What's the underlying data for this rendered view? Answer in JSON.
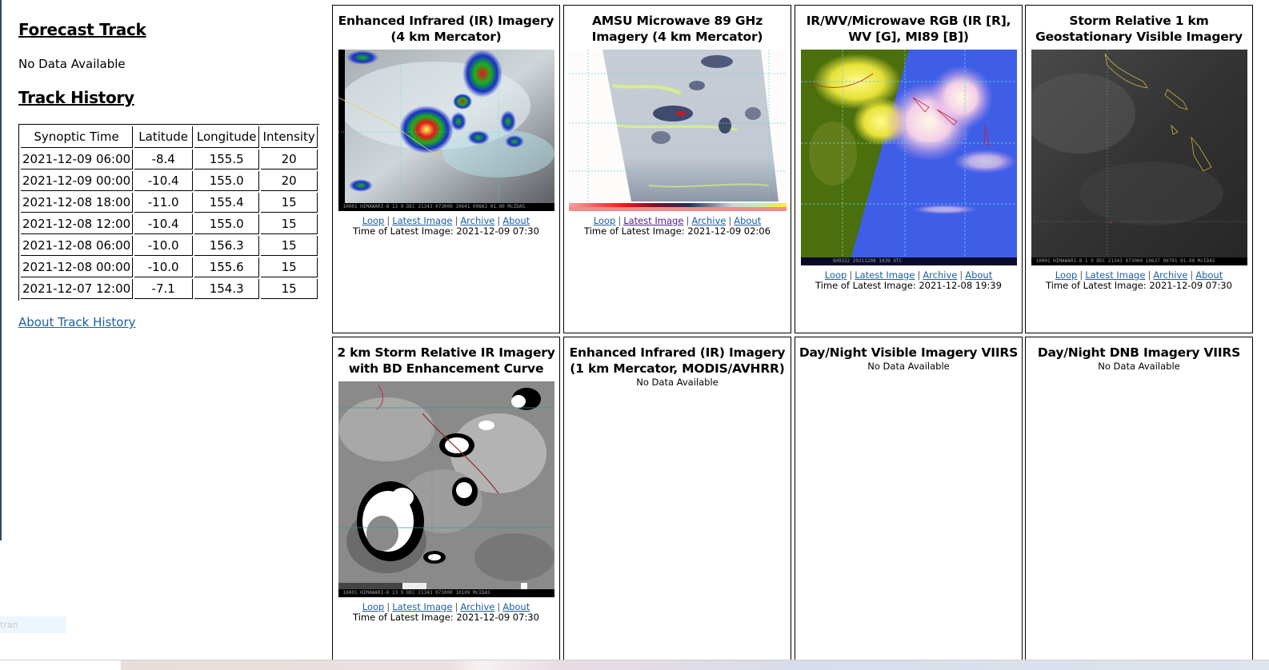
{
  "forecast_track": {
    "heading": "Forecast Track",
    "status": "No Data Available"
  },
  "track_history": {
    "heading": "Track History",
    "columns": [
      "Synoptic Time",
      "Latitude",
      "Longitude",
      "Intensity"
    ],
    "rows": [
      [
        "2021-12-09 06:00",
        "-8.4",
        "155.5",
        "20"
      ],
      [
        "2021-12-09 00:00",
        "-10.4",
        "155.0",
        "20"
      ],
      [
        "2021-12-08 18:00",
        "-11.0",
        "155.4",
        "15"
      ],
      [
        "2021-12-08 12:00",
        "-10.4",
        "155.0",
        "15"
      ],
      [
        "2021-12-08 06:00",
        "-10.0",
        "156.3",
        "15"
      ],
      [
        "2021-12-08 00:00",
        "-10.0",
        "155.6",
        "15"
      ],
      [
        "2021-12-07 12:00",
        "-7.1",
        "154.3",
        "15"
      ]
    ],
    "about_link": "About Track History"
  },
  "translate_stub": "tran",
  "link_labels": {
    "loop": "Loop",
    "latest": "Latest Image",
    "archive": "Archive",
    "about": "About",
    "separator": "|",
    "time_prefix": "Time of Latest Image:"
  },
  "panels": [
    {
      "title": "Enhanced Infrared (IR) Imagery (4 km Mercator)",
      "image": "enhanced-ir-4km",
      "caption": "10001 HIMAWARI-8 13  9 DEC 21343 073000 10641 09663 01.00   McIDAS",
      "latest_time": "2021-12-09 07:30"
    },
    {
      "title": "AMSU Microwave 89 GHz Imagery (4 km Mercator)",
      "image": "amsu-89ghz",
      "caption": "",
      "latest_time": "2021-12-09 02:06",
      "latest_visited": true
    },
    {
      "title": "IR/WV/Microwave RGB (IR [R], WV [G], MI89 [B])",
      "image": "ir-wv-mw-rgb",
      "caption": "SH9322 20211208 1939 UTC",
      "latest_time": "2021-12-08 19:39"
    },
    {
      "title": "Storm Relative 1 km Geostationary Visible Imagery",
      "image": "storm-relative-visible",
      "caption": "10001 HIMAWARI-8  1  9 DEC 21343 073000 10637 09701 01.00 McIDAS",
      "latest_time": "2021-12-09 07:30"
    },
    {
      "title": "2 km Storm Relative IR Imagery with BD Enhancement Curve",
      "image": "storm-relative-ir-bd",
      "caption": "10001 HIMAWARI-8 13  9 DEC 21343 073000 10109 McIDAS",
      "latest_time": "2021-12-09 07:30"
    },
    {
      "title": "Enhanced Infrared (IR) Imagery (1 km Mercator, MODIS/AVHRR)",
      "status": "No Data Available"
    },
    {
      "title": "Day/Night Visible Imagery VIIRS",
      "status": "No Data Available"
    },
    {
      "title": "Day/Night DNB Imagery VIIRS",
      "status": "No Data Available"
    }
  ]
}
